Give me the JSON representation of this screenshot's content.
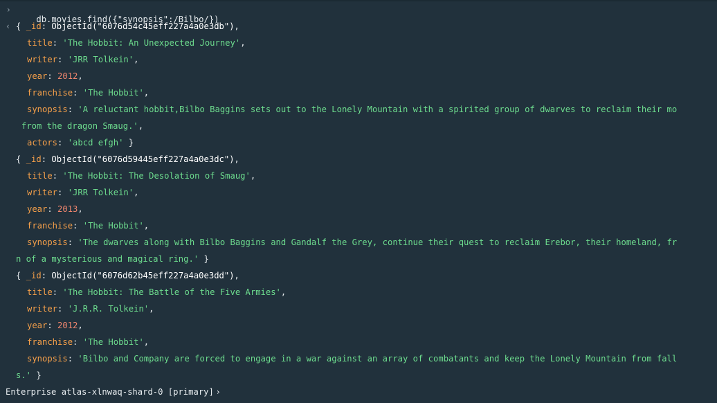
{
  "command": "db.movies.find({\"synopsis\":/Bilbo/})",
  "prompt_status": "Enterprise atlas-xlnwaq-shard-0 [primary]",
  "docs": [
    {
      "id_key": "_id",
      "id_value": "ObjectId(\"6076d54c45eff227a4a0e3db\")",
      "title": "'The Hobbit: An Unexpected Journey'",
      "writer": "'JRR Tolkein'",
      "year": "2012",
      "franchise": "'The Hobbit'",
      "synopsis_l1": "'A reluctant hobbit,Bilbo Baggins sets out to the Lonely Mountain with a spirited group of dwarves to reclaim their mo",
      "synopsis_l2": "from the dragon Smaug.'",
      "actors": "'abcd efgh'"
    },
    {
      "id_key": "_id",
      "id_value": "ObjectId(\"6076d59445eff227a4a0e3dc\")",
      "title": "'The Hobbit: The Desolation of Smaug'",
      "writer": "'JRR Tolkein'",
      "year": "2013",
      "franchise": "'The Hobbit'",
      "synopsis_l1": "'The dwarves along with Bilbo Baggins and Gandalf the Grey, continue their quest to reclaim Erebor, their homeland, fr",
      "synopsis_l2": "n of a mysterious and magical ring.'"
    },
    {
      "id_key": "_id",
      "id_value": "ObjectId(\"6076d62b45eff227a4a0e3dd\")",
      "title": "'The Hobbit: The Battle of the Five Armies'",
      "writer": "'J.R.R. Tolkein'",
      "year": "2012",
      "franchise": "'The Hobbit'",
      "synopsis_l1": "'Bilbo and Company are forced to engage in a war against an array of combatants and keep the Lonely Mountain from fall",
      "synopsis_l2": "s.'"
    }
  ],
  "keys": {
    "title": "title",
    "writer": "writer",
    "year": "year",
    "franchise": "franchise",
    "synopsis": "synopsis",
    "actors": "actors"
  },
  "colors": {
    "background": "#21313c",
    "key": "#f6a04a",
    "string": "#6ddc8e",
    "number": "#f0866e",
    "text": "#e6ebee"
  },
  "icons": {
    "input_prompt": "chevron-right-icon",
    "output_marker": "chevron-left-icon"
  }
}
